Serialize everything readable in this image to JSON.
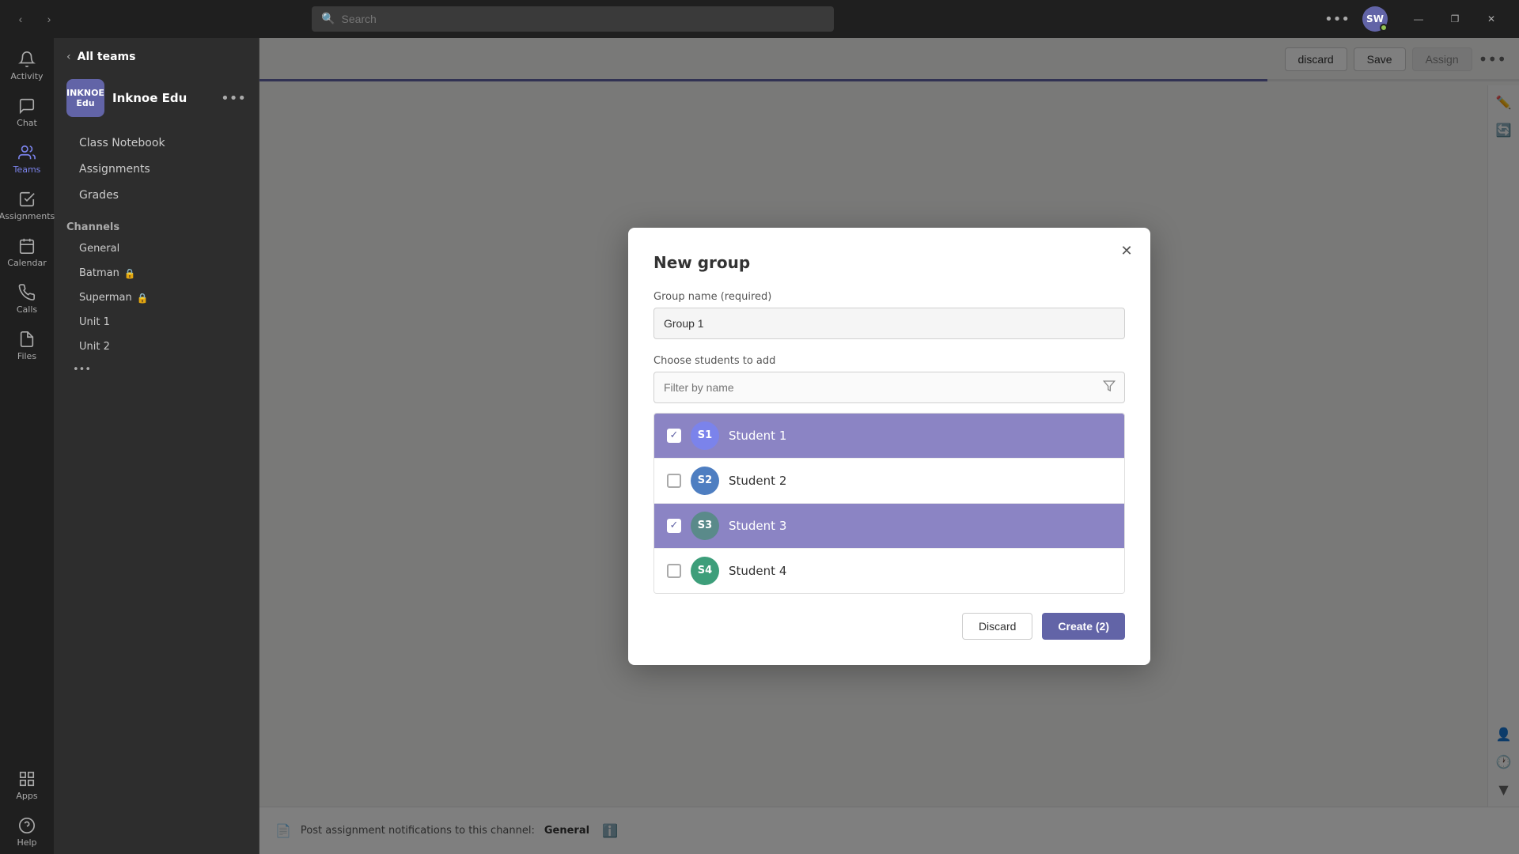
{
  "titleBar": {
    "search_placeholder": "Search",
    "more_label": "•••",
    "avatar_initials": "SW",
    "minimize": "—",
    "maximize": "❐",
    "close": "✕"
  },
  "sidebar": {
    "items": [
      {
        "id": "activity",
        "label": "Activity",
        "icon": "🔔"
      },
      {
        "id": "chat",
        "label": "Chat",
        "icon": "💬"
      },
      {
        "id": "teams",
        "label": "Teams",
        "icon": "👥",
        "active": true
      },
      {
        "id": "assignments",
        "label": "Assignments",
        "icon": "📋"
      },
      {
        "id": "calendar",
        "label": "Calendar",
        "icon": "📅"
      },
      {
        "id": "calls",
        "label": "Calls",
        "icon": "📞"
      },
      {
        "id": "files",
        "label": "Files",
        "icon": "📁"
      },
      {
        "id": "more",
        "label": "•••",
        "icon": "•••"
      },
      {
        "id": "apps",
        "label": "Apps",
        "icon": "⊞"
      },
      {
        "id": "help",
        "label": "Help",
        "icon": "?"
      }
    ]
  },
  "teamsPanel": {
    "back_label": "All teams",
    "team_name": "Inknoe Edu",
    "team_logo_text": "INKNOE\nEdu",
    "nav_items": [
      "Class Notebook",
      "Assignments",
      "Grades"
    ],
    "channels_label": "Channels",
    "channels": [
      {
        "name": "General",
        "locked": false
      },
      {
        "name": "Batman",
        "locked": true
      },
      {
        "name": "Superman",
        "locked": true
      },
      {
        "name": "Unit 1",
        "locked": false
      },
      {
        "name": "Unit 2",
        "locked": false
      }
    ],
    "more_label": "•••"
  },
  "toolbar": {
    "discard_label": "discard",
    "save_label": "Save",
    "assign_label": "Assign"
  },
  "progressBar": {
    "percent": 80
  },
  "bottomBar": {
    "channel_label": "Post assignment notifications to this channel:",
    "channel_value": "General"
  },
  "modal": {
    "title": "New group",
    "close_icon": "✕",
    "group_name_label": "Group name (required)",
    "group_name_value": "Group 1",
    "students_label": "Choose students to add",
    "filter_placeholder": "Filter by name",
    "students": [
      {
        "id": "s1",
        "initials": "S1",
        "name": "Student 1",
        "selected": true,
        "avatar_color": "#7b83eb"
      },
      {
        "id": "s2",
        "initials": "S2",
        "name": "Student 2",
        "selected": false,
        "avatar_color": "#4e7ec1"
      },
      {
        "id": "s3",
        "initials": "S3",
        "name": "Student 3",
        "selected": true,
        "avatar_color": "#5a8a8a"
      },
      {
        "id": "s4",
        "initials": "S4",
        "name": "Student 4",
        "selected": false,
        "avatar_color": "#3d9e7a"
      }
    ],
    "discard_label": "Discard",
    "create_label": "Create (2)"
  }
}
